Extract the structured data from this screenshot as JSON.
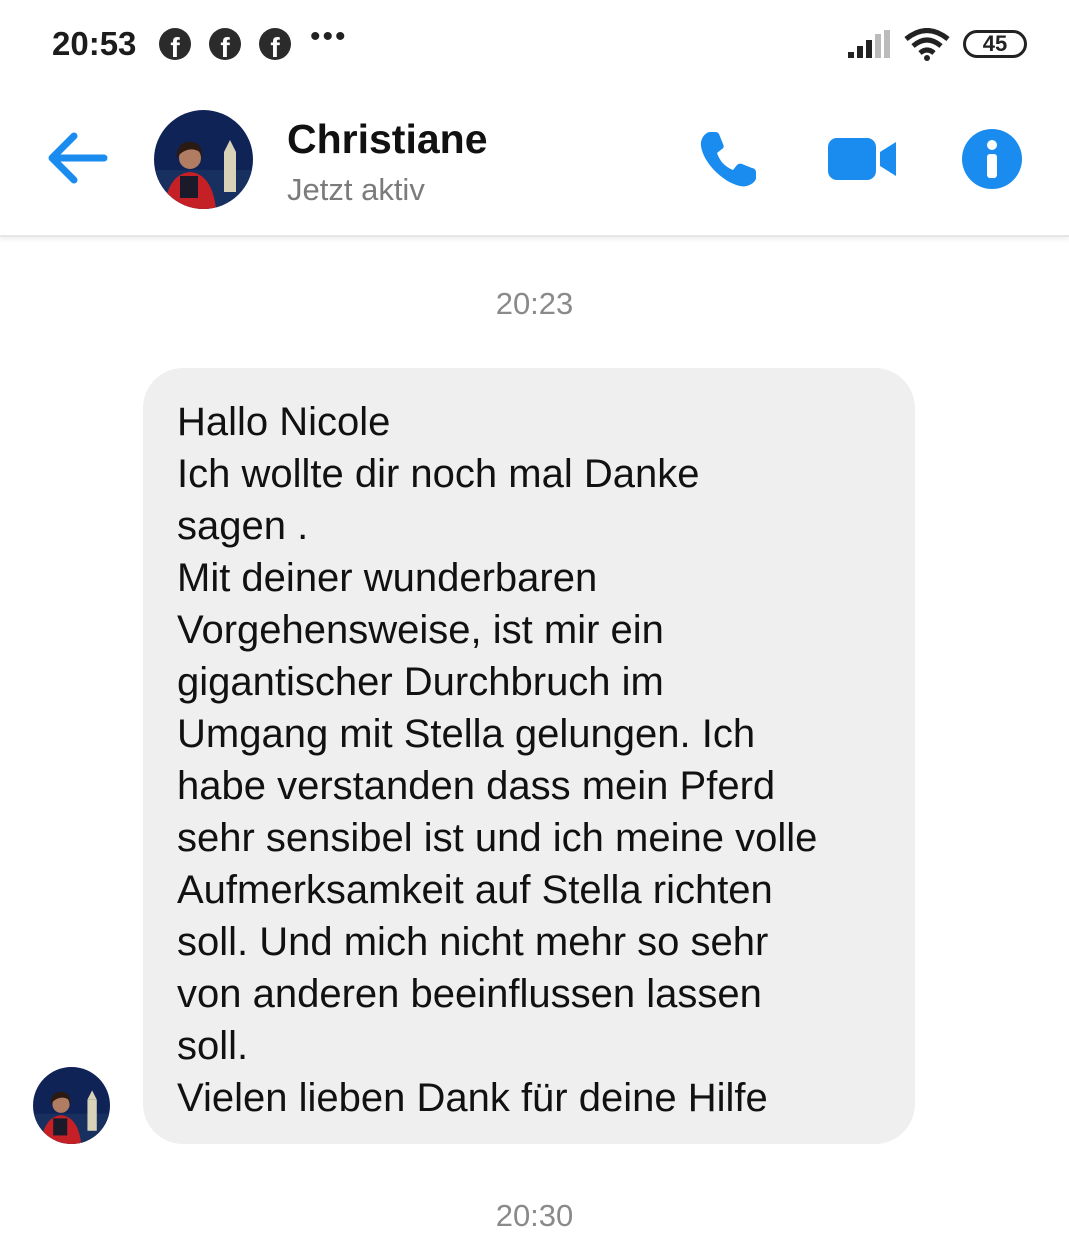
{
  "status_bar": {
    "time": "20:53",
    "notification_icons": [
      "facebook-icon",
      "facebook-icon",
      "facebook-icon"
    ],
    "more_indicator": "•••",
    "battery": "45"
  },
  "header": {
    "contact_name": "Christiane",
    "presence": "Jetzt aktiv",
    "accent_color": "#1a8cf0"
  },
  "conversation": {
    "timestamp": "20:23",
    "message_lines": [
      "Hallo Nicole",
      "Ich wollte dir noch mal Danke",
      "sagen .",
      "Mit deiner wunderbaren",
      "Vorgehensweise, ist mir ein",
      "gigantischer Durchbruch im",
      "Umgang mit Stella gelungen. Ich",
      "habe verstanden dass mein Pferd",
      "sehr sensibel ist und ich meine volle",
      "Aufmerksamkeit auf Stella richten",
      "soll. Und mich nicht mehr so sehr",
      "von anderen beeinflussen lassen",
      "soll.",
      "Vielen lieben Dank für deine Hilfe"
    ],
    "next_timestamp": "20:30"
  }
}
